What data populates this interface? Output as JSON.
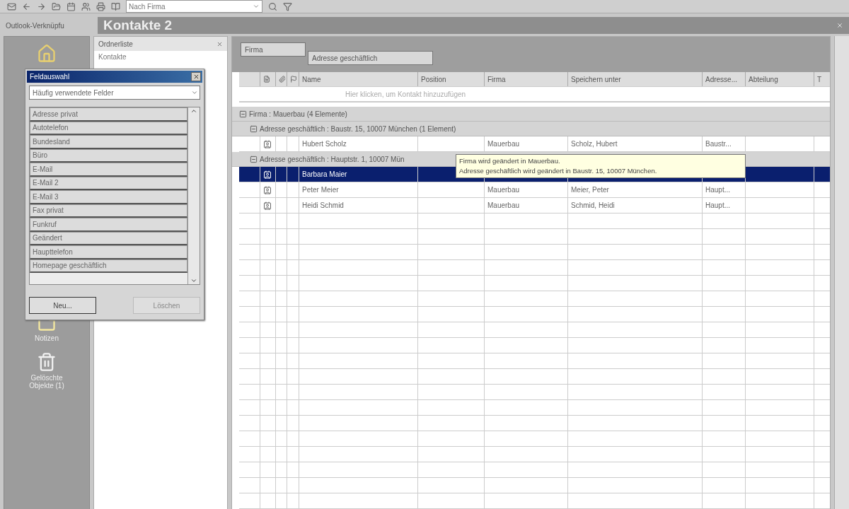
{
  "toolbar": {
    "search": {
      "value": "Nach Firma"
    }
  },
  "outlook_bar": {
    "title": "Outlook-Verknüpfu",
    "items": [
      {
        "kind": "home"
      },
      {
        "kind": "notes",
        "label": "Notizen"
      },
      {
        "kind": "trash",
        "label": "Gelöschte Objekte (1)"
      }
    ]
  },
  "folder_pane": {
    "title": "Ordnerliste",
    "items": [
      "Kontakte"
    ]
  },
  "view": {
    "title": "Kontakte 2",
    "group_by": [
      "Firma",
      "Adresse geschäftlich"
    ],
    "columns": [
      "Name",
      "Position",
      "Firma",
      "Speichern unter",
      "Adressе...",
      "Abteilung",
      "T"
    ],
    "new_row_placeholder": "Hier klicken, um Kontakt hinzuzufügen",
    "groups": [
      {
        "label": "Firma : Mauerbau (4 Elemente)",
        "expanded": true,
        "children": [
          {
            "label": "Adresse geschäftlich : Baustr. 15, 10007 München (1 Element)",
            "expanded": true,
            "rows": [
              {
                "name": "Hubert Scholz",
                "company": "Mauerbau",
                "file_as": "Scholz, Hubert",
                "address": "Baustr...",
                "selected": false
              }
            ]
          },
          {
            "label": "Adresse geschäftlich : Hauptstr. 1, 10007 Mün",
            "expanded": true,
            "rows": [
              {
                "name": "Barbara Maier",
                "selected": true
              },
              {
                "name": "Peter Meier",
                "company": "Mauerbau",
                "file_as": "Meier, Peter",
                "address": "Haupt...",
                "selected": false
              },
              {
                "name": "Heidi Schmid",
                "company": "Mauerbau",
                "file_as": "Schmid, Heidi",
                "address": "Haupt...",
                "selected": false
              }
            ]
          }
        ]
      }
    ]
  },
  "tooltip": {
    "lines": [
      "Firma wird geändert in Mauerbau.",
      "Adresse geschäftlich wird geändert in Baustr. 15, 10007 München."
    ]
  },
  "field_chooser": {
    "title": "Feldauswahl",
    "category": "Häufig verwendete Felder",
    "fields": [
      "Adresse privat",
      "Autotelefon",
      "Bundesland",
      "Büro",
      "E-Mail",
      "E-Mail 2",
      "E-Mail 3",
      "Fax privat",
      "Funkruf",
      "Geändert",
      "Haupttelefon",
      "Homepage geschäftlich"
    ],
    "buttons": [
      {
        "label": "Neu...",
        "disabled": false
      },
      {
        "label": "Löschen",
        "disabled": true
      }
    ]
  }
}
